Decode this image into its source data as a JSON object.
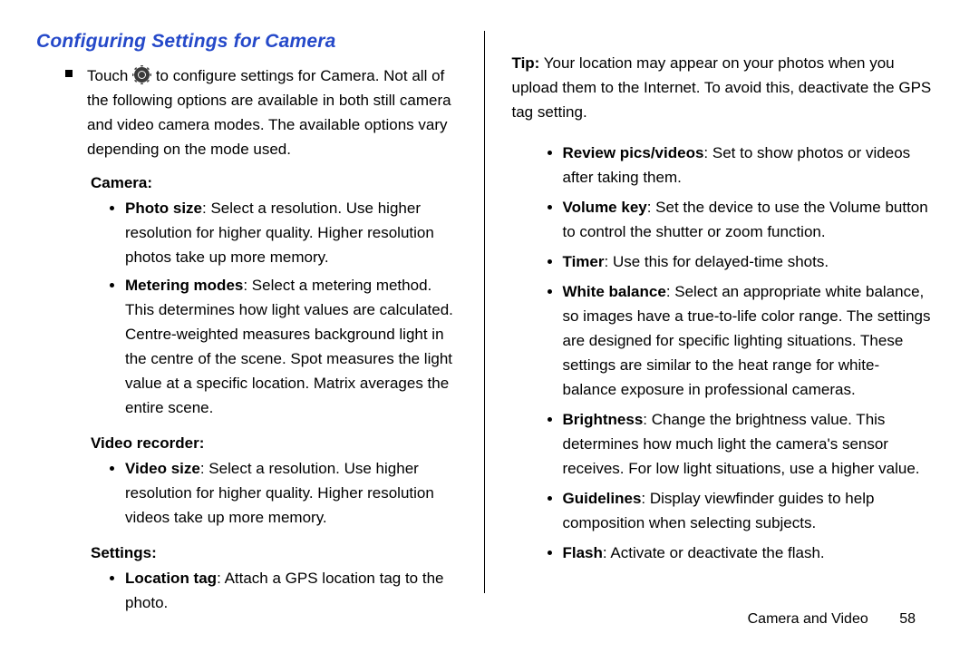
{
  "heading": "Configuring Settings for Camera",
  "intro_pre": "Touch ",
  "intro_post": " to configure settings for Camera. Not all of the following options are available in both still camera and video camera modes. The available options vary depending on the mode used.",
  "left": {
    "camera_label": "Camera",
    "camera_items": [
      {
        "title": "Photo size",
        "text": ": Select a resolution. Use higher resolution for higher quality. Higher resolution photos take up more memory."
      },
      {
        "title": "Metering modes",
        "text": ": Select a metering method. This determines how light values are calculated. Centre-weighted measures background light in the centre of the scene. Spot measures the light value at a specific location. Matrix averages the entire scene."
      }
    ],
    "video_label": "Video recorder",
    "video_items": [
      {
        "title": "Video size",
        "text": ": Select a resolution. Use higher resolution for higher quality. Higher resolution videos take up more memory."
      }
    ],
    "settings_label": "Settings",
    "settings_items": [
      {
        "title": "Location tag",
        "text": ": Attach a GPS location tag to the photo."
      }
    ]
  },
  "right": {
    "tip_label": "Tip:",
    "tip_text": " Your location may appear on your photos when you upload them to the Internet. To avoid this, deactivate the GPS tag setting.",
    "items": [
      {
        "title": "Review pics/videos",
        "text": ": Set to show photos or videos after taking them."
      },
      {
        "title": "Volume key",
        "text": ": Set the device to use the Volume button to control the shutter or zoom function."
      },
      {
        "title": "Timer",
        "text": ": Use this for delayed-time shots."
      },
      {
        "title": "White balance",
        "text": ": Select an appropriate white balance, so images have a true-to-life color range. The settings are designed for specific lighting situations. These settings are similar to the heat range for white-balance exposure in professional cameras."
      },
      {
        "title": "Brightness",
        "text": ": Change the brightness value. This determines how much light the camera's sensor receives. For low light situations, use a higher value."
      },
      {
        "title": "Guidelines",
        "text": ": Display viewfinder guides to help composition when selecting subjects."
      },
      {
        "title": "Flash",
        "text": ": Activate or deactivate the flash."
      }
    ]
  },
  "footer": {
    "section": "Camera and Video",
    "page": "58"
  }
}
